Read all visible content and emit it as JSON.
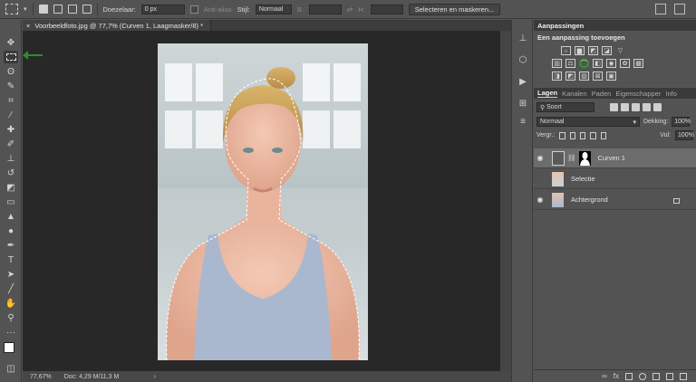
{
  "options_bar": {
    "feather_label": "Doezelaar:",
    "feather_value": "0 px",
    "antialias_label": "Anti-alias",
    "style_label": "Stijl:",
    "style_value": "Normaal",
    "width_label": "B:",
    "height_label": "H:",
    "select_mask_button": "Selecteren en maskeren..."
  },
  "document_tab": {
    "title": "Voorbeeldfoto.jpg @ 77,7% (Curven 1, Laagmasker/8) *"
  },
  "status_bar": {
    "zoom": "77,67%",
    "doc_size": "Doc: 4,29 M/11,3 M"
  },
  "adjustments_panel": {
    "title": "Aanpassingen",
    "subtitle": "Een aanpassing toevoegen"
  },
  "layers_panel": {
    "tabs": [
      "Lagen",
      "Kanalen",
      "Paden",
      "Eigenschapper",
      "Info"
    ],
    "kind_filter": "Soort",
    "blend_mode": "Normaal",
    "opacity_label": "Dekking:",
    "opacity_value": "100%",
    "lock_label": "Vergr.:",
    "fill_label": "Vul:",
    "fill_value": "100%",
    "layers": [
      {
        "name": "Curven 1",
        "visible": true,
        "selected": true
      },
      {
        "name": "Selectie",
        "visible": false,
        "selected": false
      },
      {
        "name": "Achtergrond",
        "visible": true,
        "selected": false,
        "locked": true
      }
    ]
  },
  "colors": {
    "ui_bg": "#535353",
    "canvas_bg": "#282828",
    "annotation_arrow": "#2b8f2b"
  }
}
